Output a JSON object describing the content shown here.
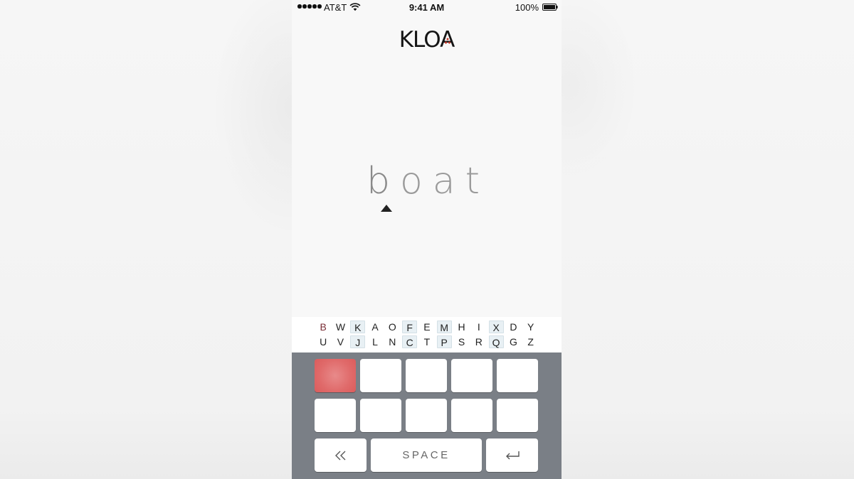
{
  "status_bar": {
    "carrier": "AT&T",
    "time": "9:41 AM",
    "battery": "100%"
  },
  "app": {
    "logo": "KLOA",
    "word": [
      "b",
      "o",
      "a",
      "t"
    ]
  },
  "alphabet": {
    "row1": [
      "B",
      "W",
      "K",
      "A",
      "O",
      "F",
      "E",
      "M",
      "H",
      "I",
      "X",
      "D",
      "Y"
    ],
    "row2": [
      "U",
      "V",
      "J",
      "L",
      "N",
      "C",
      "T",
      "P",
      "S",
      "R",
      "Q",
      "G",
      "Z"
    ],
    "highlighted_columns": [
      2,
      5,
      7,
      10
    ],
    "active_letter": "B"
  },
  "keyboard": {
    "space_label": "SPACE",
    "back_icon": "double-chevron-left-icon",
    "return_icon": "return-arrow-icon",
    "lit_color": "#e06a6a"
  }
}
